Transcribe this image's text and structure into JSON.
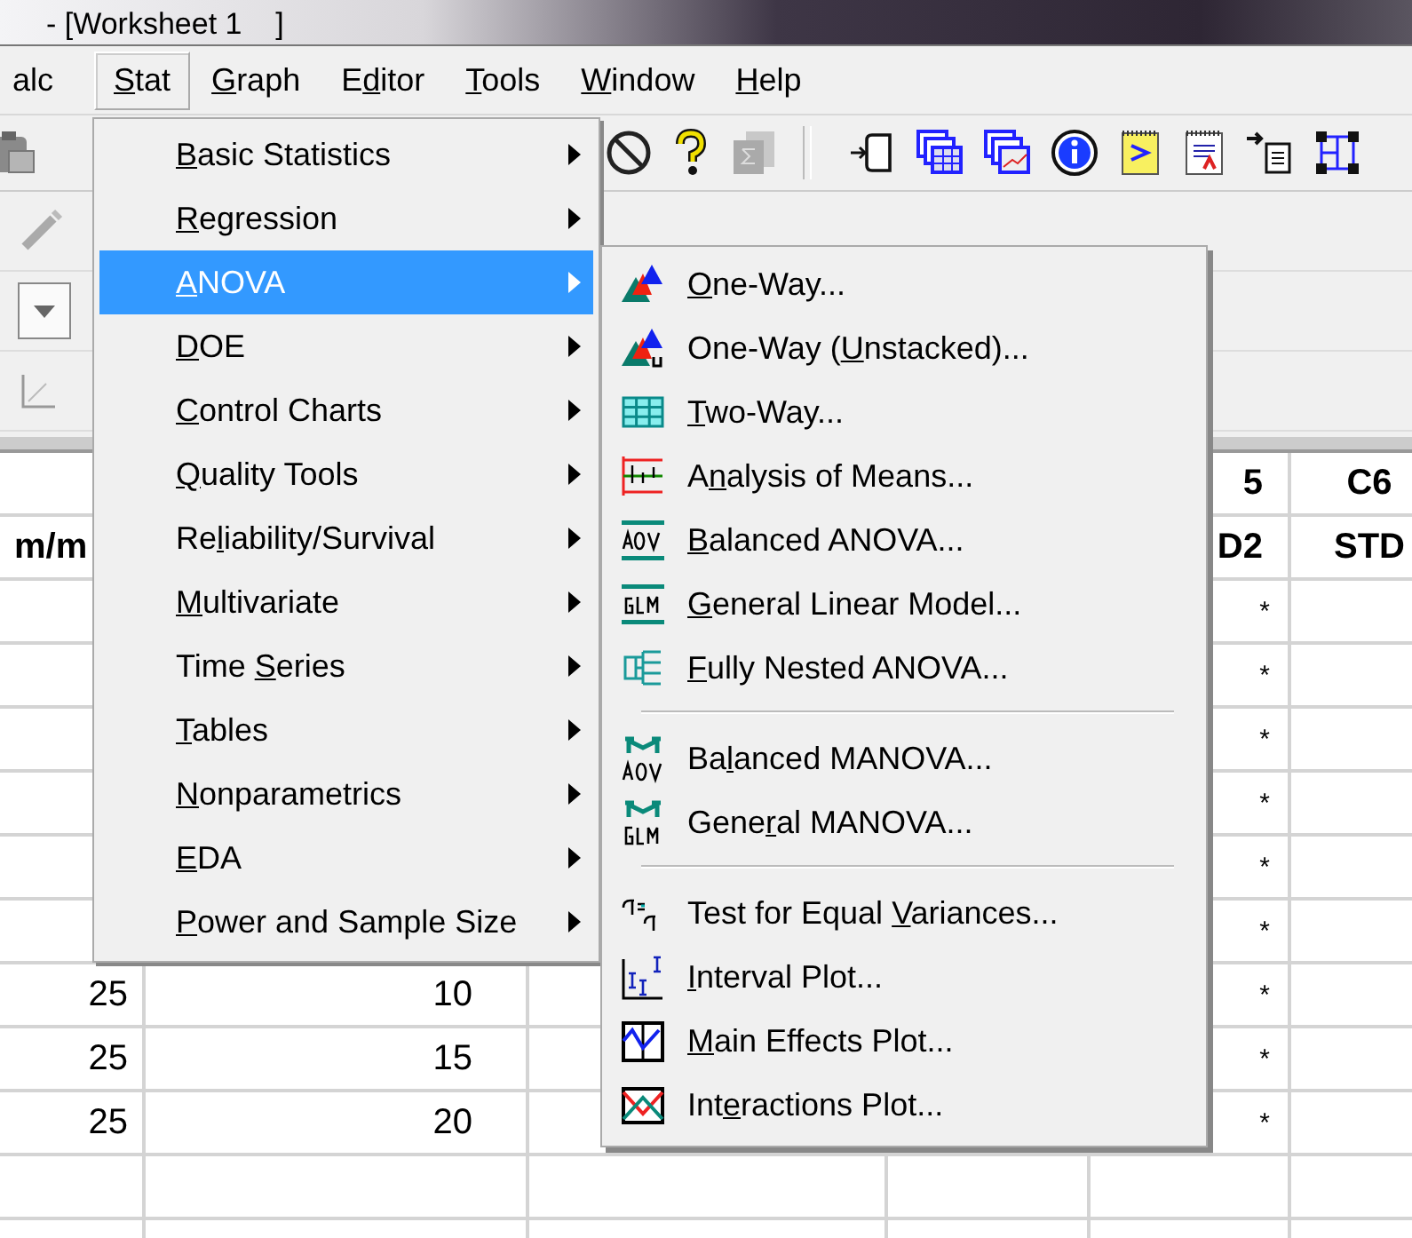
{
  "window": {
    "title": "- [Worksheet 1    ]"
  },
  "menubar": [
    {
      "post": "alc",
      "selected": false
    },
    {
      "key": "S",
      "post": "tat",
      "selected": true
    },
    {
      "key": "G",
      "post": "raph",
      "selected": false
    },
    {
      "pre": "E",
      "key": "d",
      "post": "itor",
      "selected": false
    },
    {
      "key": "T",
      "post": "ools",
      "selected": false
    },
    {
      "key": "W",
      "post": "indow",
      "selected": false
    },
    {
      "key": "H",
      "post": "elp",
      "selected": false
    }
  ],
  "stat_menu": [
    {
      "key": "B",
      "post": "asic Statistics",
      "selected": false
    },
    {
      "key": "R",
      "post": "egression",
      "selected": false
    },
    {
      "key": "A",
      "post": "NOVA",
      "selected": true
    },
    {
      "key": "D",
      "post": "OE",
      "selected": false
    },
    {
      "key": "C",
      "post": "ontrol Charts",
      "selected": false
    },
    {
      "key": "Q",
      "post": "uality Tools",
      "selected": false
    },
    {
      "pre": "Re",
      "key": "l",
      "post": "iability/Survival",
      "selected": false
    },
    {
      "key": "M",
      "post": "ultivariate",
      "selected": false
    },
    {
      "pre": "Time ",
      "key": "S",
      "post": "eries",
      "selected": false
    },
    {
      "key": "T",
      "post": "ables",
      "selected": false
    },
    {
      "key": "N",
      "post": "onparametrics",
      "selected": false
    },
    {
      "key": "E",
      "post": "DA",
      "selected": false
    },
    {
      "key": "P",
      "post": "ower and Sample Size",
      "selected": false
    }
  ],
  "anova_menu": [
    [
      {
        "key": "O",
        "post": "ne-Way..."
      },
      {
        "pre": "One-Way (",
        "key": "U",
        "post": "nstacked)..."
      },
      {
        "key": "T",
        "post": "wo-Way..."
      },
      {
        "pre": "A",
        "key": "n",
        "post": "alysis of Means..."
      },
      {
        "key": "B",
        "post": "alanced ANOVA..."
      },
      {
        "key": "G",
        "post": "eneral Linear Model..."
      },
      {
        "key": "F",
        "post": "ully Nested ANOVA..."
      }
    ],
    [
      {
        "pre": "Ba",
        "key": "l",
        "post": "anced MANOVA..."
      },
      {
        "pre": "Gene",
        "key": "r",
        "post": "al MANOVA..."
      }
    ],
    [
      {
        "pre": "Test for Equal ",
        "key": "V",
        "post": "ariances..."
      },
      {
        "key": "I",
        "post": "nterval Plot..."
      },
      {
        "key": "M",
        "post": "ain Effects Plot..."
      },
      {
        "pre": "Int",
        "key": "e",
        "post": "ractions Plot..."
      }
    ]
  ],
  "worksheet": {
    "columns": [
      {
        "name": "m/m"
      },
      {},
      {},
      {},
      {
        "header": "5",
        "name": "D2"
      },
      {
        "header": "C6",
        "name": "STD"
      }
    ],
    "rows": [
      {
        "column_5": "*"
      },
      {
        "column_5": "*"
      },
      {
        "column_5": "*"
      },
      {
        "column_5": "*"
      },
      {
        "column_5": "*"
      },
      {
        "column_5": "*"
      },
      {
        "column_1": "25",
        "column_2": "10",
        "column_5": "*"
      },
      {
        "column_1": "25",
        "column_2": "15",
        "column_5": "*"
      },
      {
        "column_1": "25",
        "column_2": "20",
        "column_5": "*"
      }
    ]
  }
}
